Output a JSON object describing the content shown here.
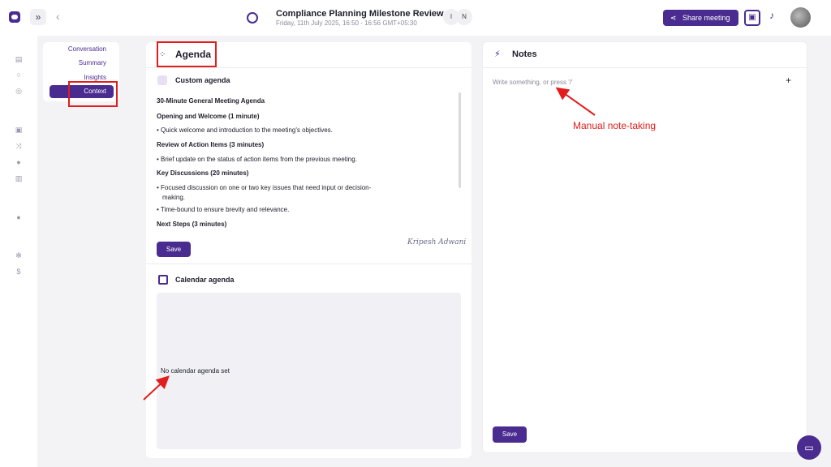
{
  "header": {
    "title": "Compliance Planning Milestone Review",
    "subtitle": "Friday, 11th July 2025, 16:50 - 16:56 GMT+05:30",
    "participants": [
      "I",
      "N"
    ],
    "share_label": "Share meeting",
    "icons": {
      "logo": "app-logo-icon",
      "expand": "double-chevron-right-icon",
      "back": "chevron-left-icon",
      "meeting": "meeting-icon",
      "share": "share-icon",
      "gift": "gift-icon",
      "bell": "bell-icon"
    }
  },
  "rail": {
    "icons": [
      "chart-icon",
      "search-icon",
      "zoom-icon",
      "chat-icon",
      "shuffle-icon",
      "drop-icon",
      "bar-chart-icon",
      "person-icon",
      "gear-icon",
      "dollar-icon"
    ]
  },
  "tabs": [
    {
      "label": "Conversation"
    },
    {
      "label": "Summary"
    },
    {
      "label": "Insights"
    },
    {
      "label": "Context",
      "active": true
    }
  ],
  "agenda": {
    "title": "Agenda",
    "custom_title": "Custom agenda",
    "heading": "30-Minute General Meeting Agenda",
    "sections": [
      {
        "title": "Opening and Welcome (1 minute)",
        "bullets": [
          "Quick welcome and introduction to the meeting's objectives."
        ]
      },
      {
        "title": "Review of Action Items (3 minutes)",
        "bullets": [
          "Brief update on the status of action items from the previous meeting."
        ]
      },
      {
        "title": "Key Discussions (20 minutes)",
        "bullets": [
          "Focused discussion on one or two key issues that need input or decision-",
          "making.",
          "Time-bound to ensure brevity and relevance."
        ]
      },
      {
        "title": "Next Steps (3 minutes)",
        "bullets": []
      }
    ],
    "bullet_lines": [
      "• Quick welcome and introduction to the meeting's objectives.",
      "• Brief update on the status of action items from the previous meeting.",
      "• Focused discussion on one or two key issues that need input or decision-",
      "making.",
      "• Time-bound to ensure brevity and relevance."
    ],
    "save_label": "Save",
    "signature": "Kripesh Adwani",
    "calendar_title": "Calendar agenda",
    "calendar_empty": "No calendar agenda set"
  },
  "notes": {
    "title": "Notes",
    "placeholder": "Write something, or press '/'",
    "save_label": "Save"
  },
  "annotation": {
    "text": "Manual note-taking",
    "color": "#e11d1d"
  },
  "colors": {
    "accent": "#4a2b8f",
    "background": "#f3f3f6",
    "panel": "#ffffff"
  }
}
